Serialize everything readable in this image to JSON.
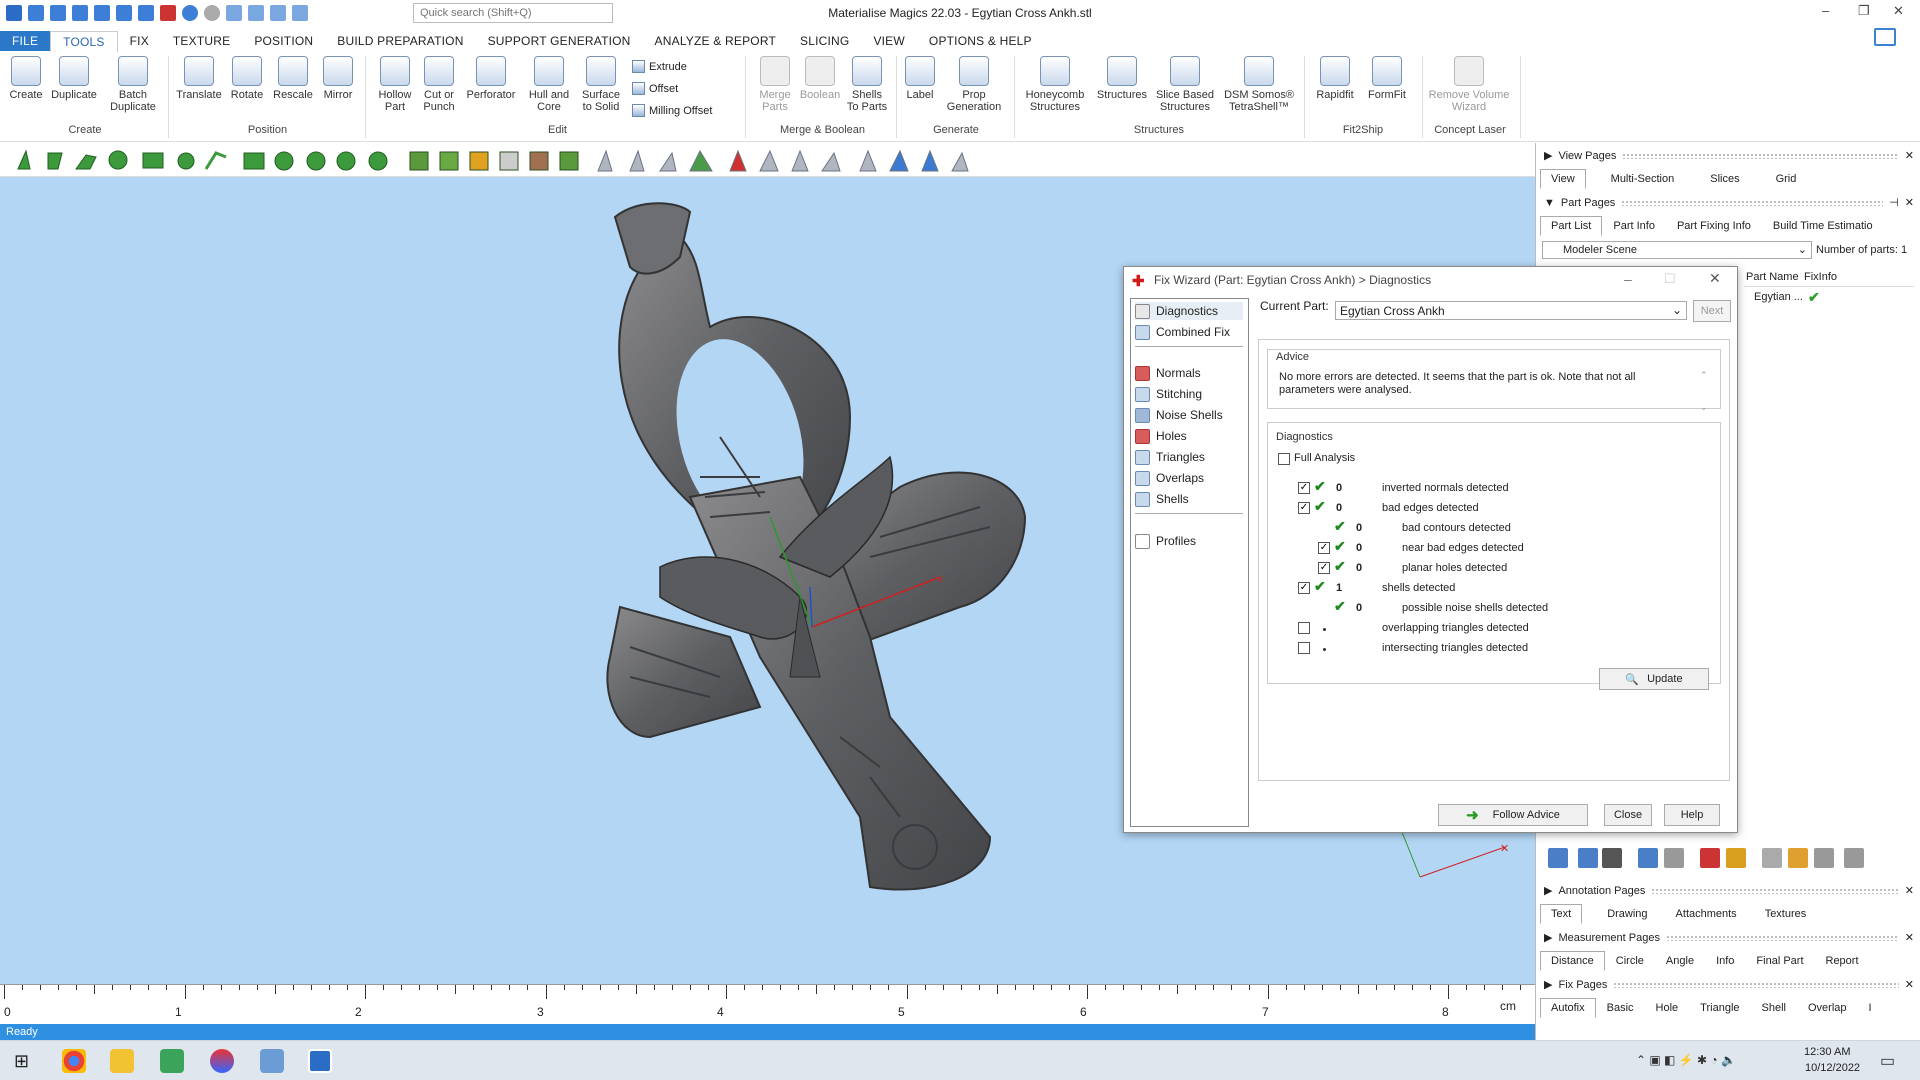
{
  "window": {
    "title": "Materialise Magics 22.03 - Egytian Cross  Ankh.stl",
    "search_placeholder": "Quick search (Shift+Q)"
  },
  "menu": [
    "FILE",
    "TOOLS",
    "FIX",
    "TEXTURE",
    "POSITION",
    "BUILD PREPARATION",
    "SUPPORT GENERATION",
    "ANALYZE & REPORT",
    "SLICING",
    "VIEW",
    "OPTIONS & HELP"
  ],
  "ribbon": {
    "buttons": {
      "create": "Create",
      "duplicate": "Duplicate",
      "batch": "Batch\nDuplicate",
      "translate": "Translate",
      "rotate": "Rotate",
      "rescale": "Rescale",
      "mirror": "Mirror",
      "hollow": "Hollow\nPart",
      "cut": "Cut or\nPunch",
      "perforator": "Perforator",
      "hull": "Hull and\nCore",
      "surface": "Surface\nto Solid",
      "extrude": "Extrude",
      "offset": "Offset",
      "milling": "Milling Offset",
      "merge": "Merge\nParts",
      "boolean": "Boolean",
      "shells": "Shells\nTo Parts",
      "label": "Label",
      "prop": "Prop\nGeneration",
      "honeycomb": "Honeycomb\nStructures",
      "structures": "Structures",
      "slice": "Slice Based\nStructures",
      "dsm": "DSM Somos®\nTetraShell™",
      "rapidfit": "Rapidfit",
      "formfit": "FormFit",
      "remove": "Remove Volume\nWizard"
    },
    "groups": {
      "create": "Create",
      "position": "Position",
      "edit": "Edit",
      "merge": "Merge & Boolean",
      "generate": "Generate",
      "structures": "Structures",
      "fit": "Fit2Ship",
      "concept": "Concept Laser"
    }
  },
  "ruler": {
    "labels": [
      "0",
      "1",
      "2",
      "3",
      "4",
      "5",
      "6",
      "7",
      "8"
    ],
    "unit": "cm"
  },
  "status": "Ready",
  "taskbar": {
    "time": "12:30 AM",
    "date": "10/12/2022"
  },
  "panes": {
    "view_pages": {
      "title": "View Pages",
      "tabs": [
        "View",
        "Multi-Section",
        "Slices",
        "Grid"
      ]
    },
    "part_pages": {
      "title": "Part Pages",
      "tabs": [
        "Part List",
        "Part Info",
        "Part Fixing Info",
        "Build Time Estimatio"
      ],
      "scene": "Modeler Scene",
      "num_parts_label": "Number of parts: 1",
      "col_name": "Part Name",
      "col_fix": "FixInfo",
      "row_name": "Egytian ..."
    },
    "annotation_pages": {
      "title": "Annotation Pages",
      "tabs": [
        "Text",
        "Drawing",
        "Attachments",
        "Textures"
      ]
    },
    "measurement_pages": {
      "title": "Measurement Pages",
      "tabs": [
        "Distance",
        "Circle",
        "Angle",
        "Info",
        "Final Part",
        "Report"
      ]
    },
    "fix_pages": {
      "title": "Fix Pages",
      "tabs": [
        "Autofix",
        "Basic",
        "Hole",
        "Triangle",
        "Shell",
        "Overlap",
        "I"
      ]
    }
  },
  "dialog": {
    "title": "Fix Wizard (Part: Egytian Cross  Ankh) > Diagnostics",
    "nav": [
      "Diagnostics",
      "Combined Fix",
      "Normals",
      "Stitching",
      "Noise Shells",
      "Holes",
      "Triangles",
      "Overlaps",
      "Shells",
      "Profiles"
    ],
    "current_part_label": "Current Part:",
    "current_part": "Egytian Cross  Ankh",
    "next": "Next",
    "advice_title": "Advice",
    "advice_text": "No more errors are detected. It seems that the part is ok. Note that not all parameters were analysed.",
    "diag_title": "Diagnostics",
    "full_analysis": "Full Analysis",
    "rows": [
      {
        "num": "0",
        "label": "inverted normals detected"
      },
      {
        "num": "0",
        "label": "bad edges detected"
      },
      {
        "num": "0",
        "label": "bad contours detected"
      },
      {
        "num": "0",
        "label": "near bad edges detected"
      },
      {
        "num": "0",
        "label": "planar holes detected"
      },
      {
        "num": "1",
        "label": "shells detected"
      },
      {
        "num": "0",
        "label": "possible noise shells detected"
      },
      {
        "num": "",
        "label": "overlapping triangles detected"
      },
      {
        "num": "",
        "label": "intersecting triangles detected"
      }
    ],
    "update": "Update",
    "follow": "Follow Advice",
    "close": "Close",
    "help": "Help"
  }
}
